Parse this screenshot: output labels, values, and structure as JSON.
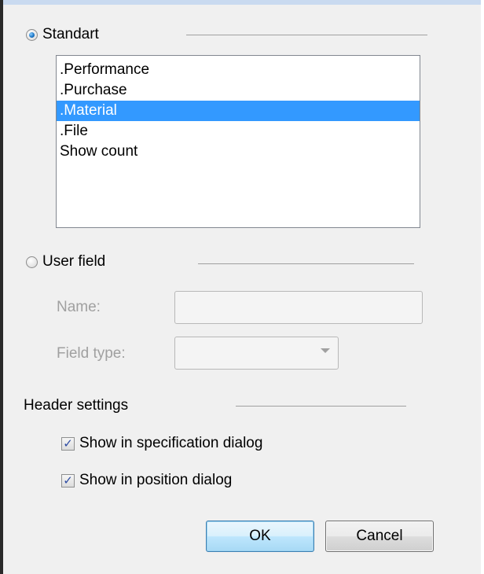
{
  "standard_option": {
    "label": "Standart",
    "selected": true
  },
  "standard_list": {
    "items": [
      ".Performance",
      ".Purchase",
      ".Material",
      ".File",
      "Show count"
    ],
    "selected_index": 2
  },
  "user_field_option": {
    "label": "User field",
    "selected": false
  },
  "name_field": {
    "label": "Name:",
    "value": ""
  },
  "field_type": {
    "label": "Field type:",
    "value": ""
  },
  "header_settings": {
    "title": "Header settings",
    "show_in_spec": {
      "label": "Show in specification dialog",
      "checked": true
    },
    "show_in_position": {
      "label": "Show in position dialog",
      "checked": true
    }
  },
  "buttons": {
    "ok": "OK",
    "cancel": "Cancel"
  },
  "colors": {
    "selection": "#3399ff",
    "dialog_bg": "#f0f0f0",
    "disabled_text": "#a0a0a0"
  }
}
